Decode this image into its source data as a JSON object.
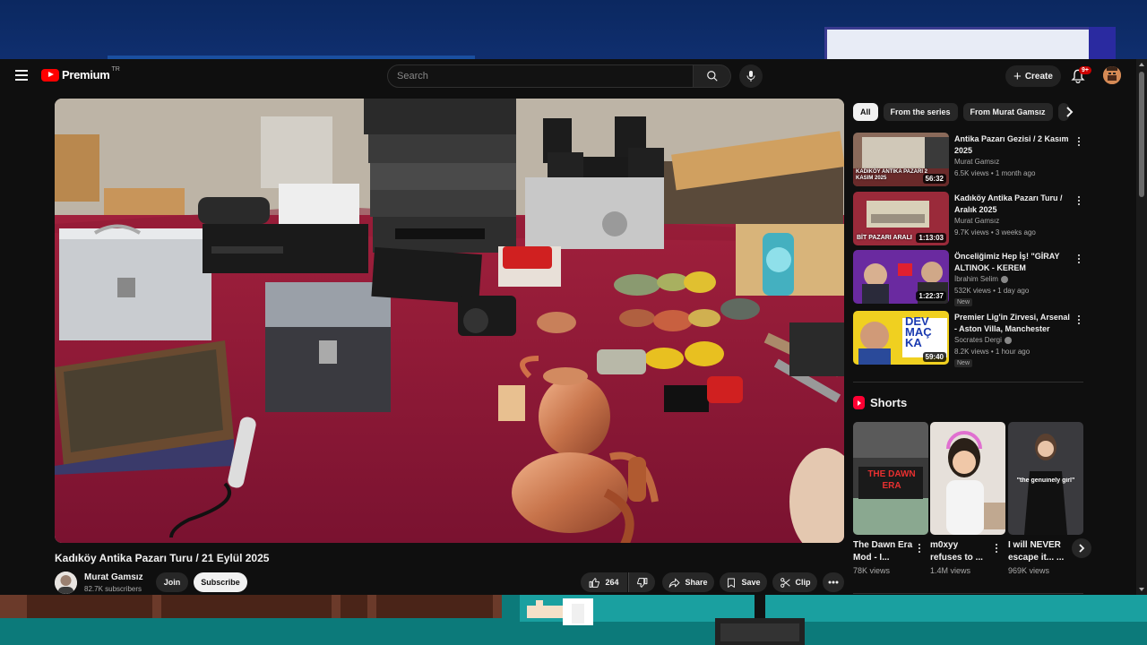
{
  "header": {
    "brand": "Premium",
    "country_code": "TR",
    "search_placeholder": "Search",
    "create_label": "Create",
    "notifications_badge": "9+"
  },
  "video": {
    "title": "Kadıköy Antika Pazarı Turu / 21 Eylül 2025",
    "channel": "Murat Gamsız",
    "subscribers": "82.7K subscribers",
    "join_label": "Join",
    "subscribe_label": "Subscribe",
    "likes": "264",
    "share_label": "Share",
    "save_label": "Save",
    "clip_label": "Clip"
  },
  "sidebar": {
    "chips": [
      "All",
      "From the series",
      "From Murat Gamsız"
    ],
    "recommendations": [
      {
        "title": "Antika Pazarı Gezisi / 2 Kasım 2025",
        "channel": "Murat Gamsız",
        "meta": "6.5K views • 1 month ago",
        "duration": "56:32",
        "thumb_text": "KADIKÖY ANTIKA PAZARI 2 KASIM 2025",
        "badge": "",
        "verified": false
      },
      {
        "title": "Kadıköy Antika Pazarı Turu / Aralık 2025",
        "channel": "Murat Gamsız",
        "meta": "9.7K views • 3 weeks ago",
        "duration": "1:13:03",
        "thumb_text": "BİT PAZARI ARALI",
        "badge": "",
        "verified": false
      },
      {
        "title": "Önceliğimiz Hep İş! \"GİRAY ALTINOK - KEREM ÖZDOĞAN\" ...",
        "channel": "İbrahim Selim",
        "meta": "532K views • 1 day ago",
        "duration": "1:22:37",
        "thumb_text": "",
        "badge": "New",
        "verified": true
      },
      {
        "title": "Premier Lig'in Zirvesi, Arsenal - Aston Villa, Manchester Turu, ...",
        "channel": "Socrates Dergi",
        "meta": "8.2K views • 1 hour ago",
        "duration": "59:40",
        "thumb_text": "DEV MAÇ KA",
        "badge": "New",
        "verified": true
      }
    ],
    "shorts_title": "Shorts",
    "shorts": [
      {
        "title": "The Dawn Era Mod - I...",
        "views": "78K views",
        "thumb_text": "THE DAWN ERA"
      },
      {
        "title": "m0xyy refuses to ...",
        "views": "1.4M views",
        "thumb_text": ""
      },
      {
        "title": "I will NEVER escape it... ...",
        "views": "969K views",
        "thumb_text": "\"the genuinely girl\""
      }
    ]
  },
  "colors": {
    "background": "#0f0f0f",
    "accent": "#ff0000",
    "chip_active": "#f1f1f1",
    "tablecloth": "#8a1a34"
  },
  "icons": [
    "menu-icon",
    "search-icon",
    "mic-icon",
    "plus-icon",
    "bell-icon",
    "thumbs-up-icon",
    "thumbs-down-icon",
    "share-icon",
    "bookmark-icon",
    "scissors-icon",
    "more-icon",
    "chevron-right-icon",
    "shorts-icon",
    "verified-icon"
  ]
}
